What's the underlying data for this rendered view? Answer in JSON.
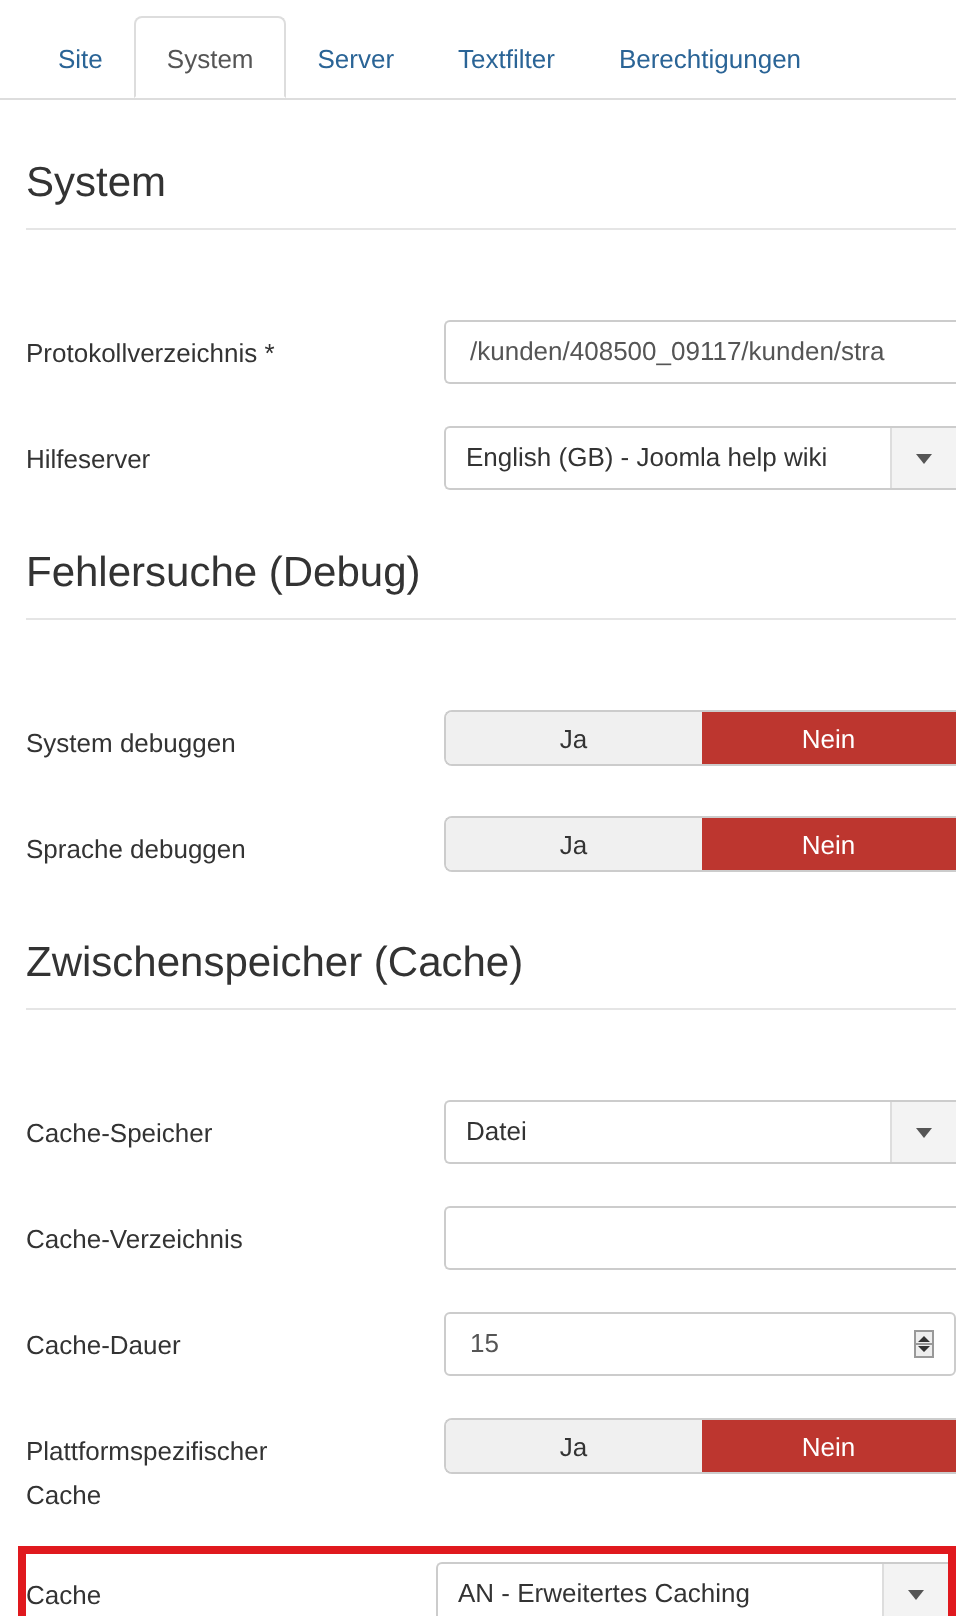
{
  "tabs": [
    {
      "label": "Site",
      "selected": false
    },
    {
      "label": "System",
      "selected": true
    },
    {
      "label": "Server",
      "selected": false
    },
    {
      "label": "Textfilter",
      "selected": false
    },
    {
      "label": "Berechtigungen",
      "selected": false
    }
  ],
  "sections": [
    {
      "title": "System",
      "fields": [
        {
          "kind": "text",
          "label": "Protokollverzeichnis *",
          "value": "/kunden/408500_09117/kunden/stra"
        },
        {
          "kind": "select",
          "label": "Hilfeserver",
          "value": "English (GB) - Joomla help wiki"
        }
      ]
    },
    {
      "title": "Fehlersuche (Debug)",
      "fields": [
        {
          "kind": "toggle",
          "label": "System debuggen",
          "options": [
            {
              "label": "Ja",
              "selected": false
            },
            {
              "label": "Nein",
              "selected": true
            }
          ]
        },
        {
          "kind": "toggle",
          "label": "Sprache debuggen",
          "options": [
            {
              "label": "Ja",
              "selected": false
            },
            {
              "label": "Nein",
              "selected": true
            }
          ]
        }
      ]
    },
    {
      "title": "Zwischenspeicher (Cache)",
      "fields": [
        {
          "kind": "select",
          "label": "Cache-Speicher",
          "value": "Datei"
        },
        {
          "kind": "text",
          "label": "Cache-Verzeichnis"
        },
        {
          "kind": "number",
          "label": "Cache-Dauer",
          "value": "15"
        },
        {
          "kind": "toggle",
          "label": "Plattformspezifischer Cache",
          "options": [
            {
              "label": "Ja",
              "selected": false
            },
            {
              "label": "Nein",
              "selected": true
            }
          ]
        },
        {
          "kind": "select",
          "label": "Cache",
          "value": "AN - Erweitertes Caching",
          "highlighted": true
        }
      ]
    }
  ]
}
